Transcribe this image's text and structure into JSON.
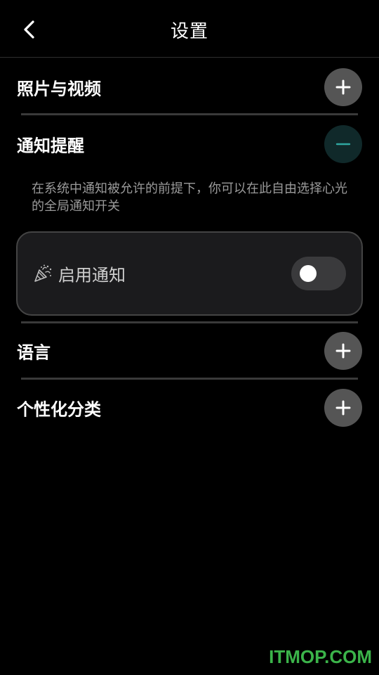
{
  "header": {
    "title": "设置",
    "back_icon": "chevron-left-icon"
  },
  "sections": {
    "photos": {
      "label": "照片与视频",
      "toggle_icon": "plus-icon"
    },
    "notifications": {
      "label": "通知提醒",
      "toggle_icon": "minus-icon",
      "description": "在系统中通知被允许的前提下，你可以在此自由选择心光的全局通知开关",
      "enable": {
        "label": "启用通知",
        "icon": "party-popper-icon",
        "enabled": false
      }
    },
    "language": {
      "label": "语言",
      "toggle_icon": "plus-icon"
    },
    "categories": {
      "label": "个性化分类",
      "toggle_icon": "plus-icon"
    }
  },
  "watermark": "ITMOP.COM",
  "colors": {
    "background": "#000000",
    "plus_button": "#555555",
    "minus_button": "#10292a",
    "minus_accent": "#2fa7a0",
    "watermark": "#3bb44a"
  }
}
